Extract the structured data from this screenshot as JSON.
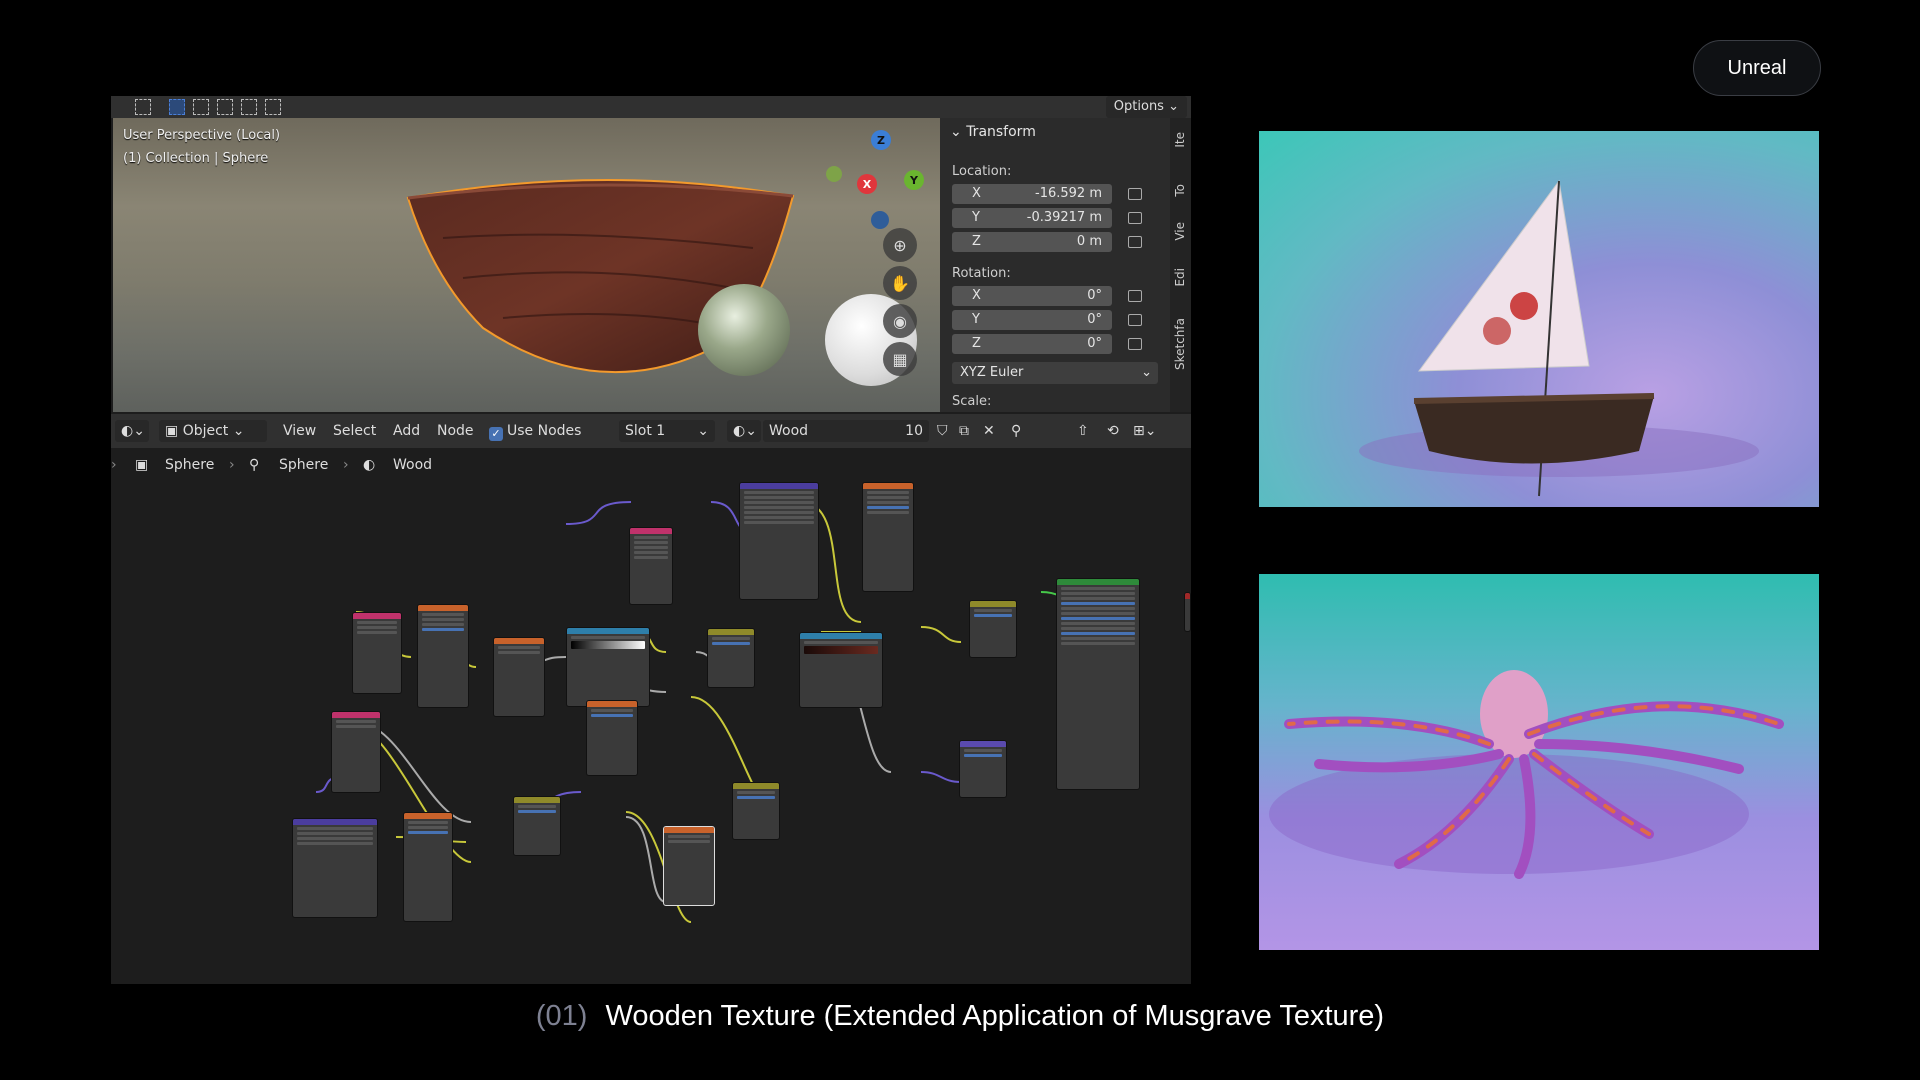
{
  "top_button": "Unreal",
  "viewport": {
    "options_label": "Options",
    "line1": "User Perspective (Local)",
    "line2": "(1) Collection | Sphere",
    "gizmo": {
      "z": "Z",
      "x": "X",
      "y": "Y"
    }
  },
  "transform_panel": {
    "title": "Transform",
    "location_label": "Location:",
    "location": [
      {
        "axis": "X",
        "value": "-16.592 m"
      },
      {
        "axis": "Y",
        "value": "-0.39217 m"
      },
      {
        "axis": "Z",
        "value": "0 m"
      }
    ],
    "rotation_label": "Rotation:",
    "rotation": [
      {
        "axis": "X",
        "value": "0°"
      },
      {
        "axis": "Y",
        "value": "0°"
      },
      {
        "axis": "Z",
        "value": "0°"
      }
    ],
    "rotation_mode": "XYZ Euler",
    "scale_label": "Scale:"
  },
  "side_tabs": [
    "Ite",
    "To",
    "Vie",
    "Edi",
    "Sketchfa"
  ],
  "node_header": {
    "mode": "Object",
    "menu": [
      "View",
      "Select",
      "Add",
      "Node"
    ],
    "use_nodes": "Use Nodes",
    "slot": "Slot 1",
    "material": "Wood",
    "users": "10"
  },
  "breadcrumb": [
    "Sphere",
    "Sphere",
    "Wood"
  ],
  "caption": {
    "number": "(01)",
    "title": "Wooden Texture (Extended Application of Musgrave Texture)"
  },
  "colors": {
    "accent": "#4772b3",
    "outline": "#f5a030",
    "background": "#000000"
  }
}
